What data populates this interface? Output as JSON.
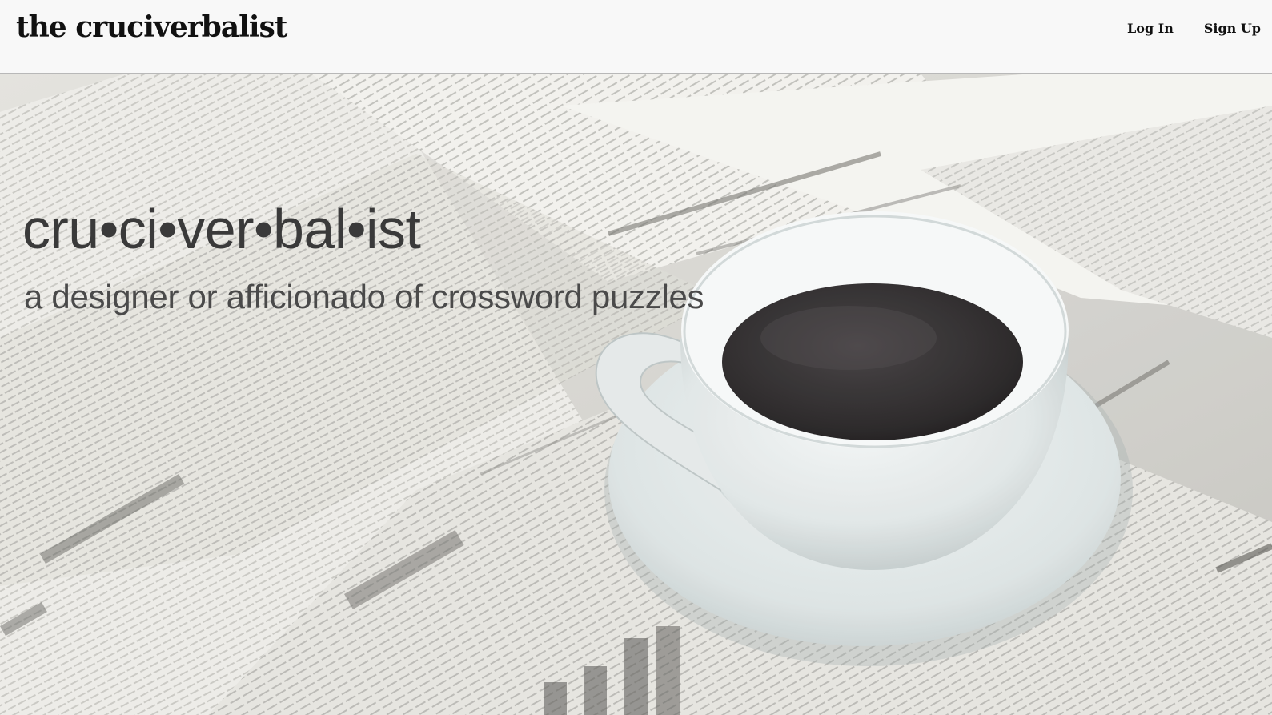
{
  "navbar": {
    "brand": "the cruciverbalist",
    "login_label": "Log In",
    "signup_label": "Sign Up"
  },
  "hero": {
    "title": "cru•ci•ver•bal•ist",
    "subtitle": "a designer or afficionado of crossword puzzles",
    "image_description": "coffee-cup-on-newspapers"
  },
  "colors": {
    "navbar_bg": "#f8f8f8",
    "text_dark": "#111111",
    "hero_text": "#3a3a3a"
  }
}
